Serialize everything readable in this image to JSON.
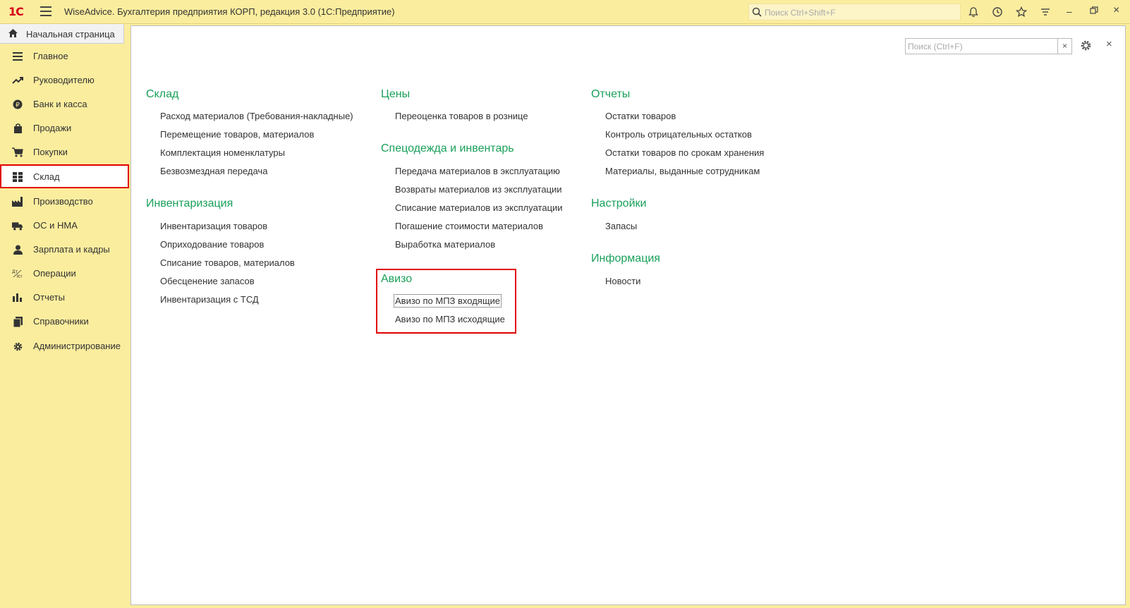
{
  "titlebar": {
    "logo": "1С",
    "title": "WiseAdvice. Бухгалтерия предприятия КОРП, редакция 3.0  (1С:Предприятие)",
    "search_placeholder": "Поиск Ctrl+Shift+F"
  },
  "home_tab": {
    "label": "Начальная страница"
  },
  "sidebar": {
    "items": [
      {
        "label": "Главное",
        "icon": "menu-lines-icon"
      },
      {
        "label": "Руководителю",
        "icon": "trend-icon"
      },
      {
        "label": "Банк и касса",
        "icon": "coin-icon"
      },
      {
        "label": "Продажи",
        "icon": "bag-icon"
      },
      {
        "label": "Покупки",
        "icon": "cart-icon"
      },
      {
        "label": "Склад",
        "icon": "warehouse-icon"
      },
      {
        "label": "Производство",
        "icon": "factory-icon"
      },
      {
        "label": "ОС и НМА",
        "icon": "truck-icon"
      },
      {
        "label": "Зарплата и кадры",
        "icon": "person-icon"
      },
      {
        "label": "Операции",
        "icon": "dt-kt-icon"
      },
      {
        "label": "Отчеты",
        "icon": "bar-chart-icon"
      },
      {
        "label": "Справочники",
        "icon": "books-icon"
      },
      {
        "label": "Администрирование",
        "icon": "gear-icon"
      }
    ],
    "selected": "Склад"
  },
  "main": {
    "search_placeholder": "Поиск (Ctrl+F)",
    "clear": "×",
    "close": "×",
    "col1": {
      "sklad": {
        "title": "Склад",
        "links": [
          "Расход материалов (Требования-накладные)",
          "Перемещение товаров, материалов",
          "Комплектация номенклатуры",
          "Безвозмездная передача"
        ]
      },
      "inventar": {
        "title": "Инвентаризация",
        "links": [
          "Инвентаризация товаров",
          "Оприходование товаров",
          "Списание товаров, материалов",
          "Обесценение запасов",
          "Инвентаризация с ТСД"
        ]
      }
    },
    "col2": {
      "ceny": {
        "title": "Цены",
        "links": [
          "Переоценка товаров в рознице"
        ]
      },
      "specodezhda": {
        "title": "Спецодежда и инвентарь",
        "links": [
          "Передача материалов в эксплуатацию",
          "Возвраты материалов из эксплуатации",
          "Списание материалов из эксплуатации",
          "Погашение стоимости материалов",
          "Выработка материалов"
        ]
      },
      "avizo": {
        "title": "Авизо",
        "links": [
          "Авизо по МПЗ входящие",
          "Авизо по МПЗ исходящие"
        ]
      }
    },
    "col3": {
      "otchety": {
        "title": "Отчеты",
        "links": [
          "Остатки товаров",
          "Контроль отрицательных остатков",
          "Остатки товаров по срокам хранения",
          "Материалы, выданные сотрудникам"
        ]
      },
      "nastroiki": {
        "title": "Настройки",
        "links": [
          "Запасы"
        ]
      },
      "informacia": {
        "title": "Информация",
        "links": [
          "Новости"
        ]
      }
    }
  }
}
